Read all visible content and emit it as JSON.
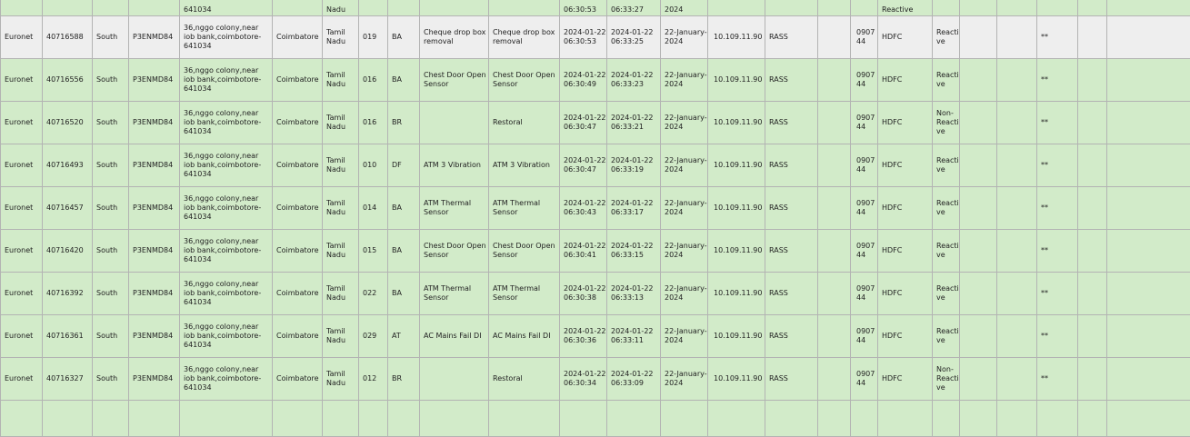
{
  "partial_top_row": {
    "address_tail": "641034",
    "state_tail": "Nadu",
    "date1_tail": "06:30:53",
    "date2_tail": "06:33:27",
    "date3_tail": "2024",
    "status_tail": "Reactive"
  },
  "rows": [
    {
      "vendor": "Euronet",
      "id": "40716588",
      "region": "South",
      "atm_id": "P3ENMD84",
      "address": "36,nggo colony,near iob bank,coimbotore-641034",
      "city": "Coimbatore",
      "state": "Tamil Nadu",
      "code": "019",
      "type": "BA",
      "alarm": "Cheque drop box removal",
      "alarm2": "Cheque drop box removal",
      "alarm_time": "2024-01-22 06:30:53",
      "recv_time": "2024-01-22 06:33:25",
      "date": "22-January-2024",
      "ip": "10.109.11.90",
      "source": "RASS",
      "branch": "090744",
      "bank": "HDFC",
      "status": "Reactive",
      "flag": "**",
      "grey": true
    },
    {
      "vendor": "Euronet",
      "id": "40716556",
      "region": "South",
      "atm_id": "P3ENMD84",
      "address": "36,nggo colony,near iob bank,coimbotore-641034",
      "city": "Coimbatore",
      "state": "Tamil Nadu",
      "code": "016",
      "type": "BA",
      "alarm": "Chest Door Open Sensor",
      "alarm2": "Chest Door Open Sensor",
      "alarm_time": "2024-01-22 06:30:49",
      "recv_time": "2024-01-22 06:33:23",
      "date": "22-January-2024",
      "ip": "10.109.11.90",
      "source": "RASS",
      "branch": "090744",
      "bank": "HDFC",
      "status": "Reactive",
      "flag": "**",
      "grey": false
    },
    {
      "vendor": "Euronet",
      "id": "40716520",
      "region": "South",
      "atm_id": "P3ENMD84",
      "address": "36,nggo colony,near iob bank,coimbotore-641034",
      "city": "Coimbatore",
      "state": "Tamil Nadu",
      "code": "016",
      "type": "BR",
      "alarm": "",
      "alarm2": "Restoral",
      "alarm_time": "2024-01-22 06:30:47",
      "recv_time": "2024-01-22 06:33:21",
      "date": "22-January-2024",
      "ip": "10.109.11.90",
      "source": "RASS",
      "branch": "090744",
      "bank": "HDFC",
      "status": "Non-Reactive",
      "flag": "**",
      "grey": false
    },
    {
      "vendor": "Euronet",
      "id": "40716493",
      "region": "South",
      "atm_id": "P3ENMD84",
      "address": "36,nggo colony,near iob bank,coimbotore-641034",
      "city": "Coimbatore",
      "state": "Tamil Nadu",
      "code": "010",
      "type": "DF",
      "alarm": "ATM 3 Vibration",
      "alarm2": "ATM 3 Vibration",
      "alarm_time": "2024-01-22 06:30:47",
      "recv_time": "2024-01-22 06:33:19",
      "date": "22-January-2024",
      "ip": "10.109.11.90",
      "source": "RASS",
      "branch": "090744",
      "bank": "HDFC",
      "status": "Reactive",
      "flag": "**",
      "grey": false
    },
    {
      "vendor": "Euronet",
      "id": "40716457",
      "region": "South",
      "atm_id": "P3ENMD84",
      "address": "36,nggo colony,near iob bank,coimbotore-641034",
      "city": "Coimbatore",
      "state": "Tamil Nadu",
      "code": "014",
      "type": "BA",
      "alarm": "ATM Thermal Sensor",
      "alarm2": "ATM Thermal Sensor",
      "alarm_time": "2024-01-22 06:30:43",
      "recv_time": "2024-01-22 06:33:17",
      "date": "22-January-2024",
      "ip": "10.109.11.90",
      "source": "RASS",
      "branch": "090744",
      "bank": "HDFC",
      "status": "Reactive",
      "flag": "**",
      "grey": false
    },
    {
      "vendor": "Euronet",
      "id": "40716420",
      "region": "South",
      "atm_id": "P3ENMD84",
      "address": "36,nggo colony,near iob bank,coimbotore-641034",
      "city": "Coimbatore",
      "state": "Tamil Nadu",
      "code": "015",
      "type": "BA",
      "alarm": "Chest Door Open Sensor",
      "alarm2": "Chest Door Open Sensor",
      "alarm_time": "2024-01-22 06:30:41",
      "recv_time": "2024-01-22 06:33:15",
      "date": "22-January-2024",
      "ip": "10.109.11.90",
      "source": "RASS",
      "branch": "090744",
      "bank": "HDFC",
      "status": "Reactive",
      "flag": "**",
      "grey": false
    },
    {
      "vendor": "Euronet",
      "id": "40716392",
      "region": "South",
      "atm_id": "P3ENMD84",
      "address": "36,nggo colony,near iob bank,coimbotore-641034",
      "city": "Coimbatore",
      "state": "Tamil Nadu",
      "code": "022",
      "type": "BA",
      "alarm": "ATM Thermal Sensor",
      "alarm2": "ATM Thermal Sensor",
      "alarm_time": "2024-01-22 06:30:38",
      "recv_time": "2024-01-22 06:33:13",
      "date": "22-January-2024",
      "ip": "10.109.11.90",
      "source": "RASS",
      "branch": "090744",
      "bank": "HDFC",
      "status": "Reactive",
      "flag": "**",
      "grey": false
    },
    {
      "vendor": "Euronet",
      "id": "40716361",
      "region": "South",
      "atm_id": "P3ENMD84",
      "address": "36,nggo colony,near iob bank,coimbotore-641034",
      "city": "Coimbatore",
      "state": "Tamil Nadu",
      "code": "029",
      "type": "AT",
      "alarm": "AC Mains Fail DI",
      "alarm2": "AC Mains Fail DI",
      "alarm_time": "2024-01-22 06:30:36",
      "recv_time": "2024-01-22 06:33:11",
      "date": "22-January-2024",
      "ip": "10.109.11.90",
      "source": "RASS",
      "branch": "090744",
      "bank": "HDFC",
      "status": "Reactive",
      "flag": "**",
      "grey": false
    },
    {
      "vendor": "Euronet",
      "id": "40716327",
      "region": "South",
      "atm_id": "P3ENMD84",
      "address": "36,nggo colony,near iob bank,coimbotore-641034",
      "city": "Coimbatore",
      "state": "Tamil Nadu",
      "code": "012",
      "type": "BR",
      "alarm": "",
      "alarm2": "Restoral",
      "alarm_time": "2024-01-22 06:30:34",
      "recv_time": "2024-01-22 06:33:09",
      "date": "22-January-2024",
      "ip": "10.109.11.90",
      "source": "RASS",
      "branch": "090744",
      "bank": "HDFC",
      "status": "Non-Reactive",
      "flag": "**",
      "grey": false
    }
  ],
  "colors": {
    "row_green": "#d2ebc9",
    "row_grey": "#eeeeee",
    "border": "#b3b3b3"
  }
}
